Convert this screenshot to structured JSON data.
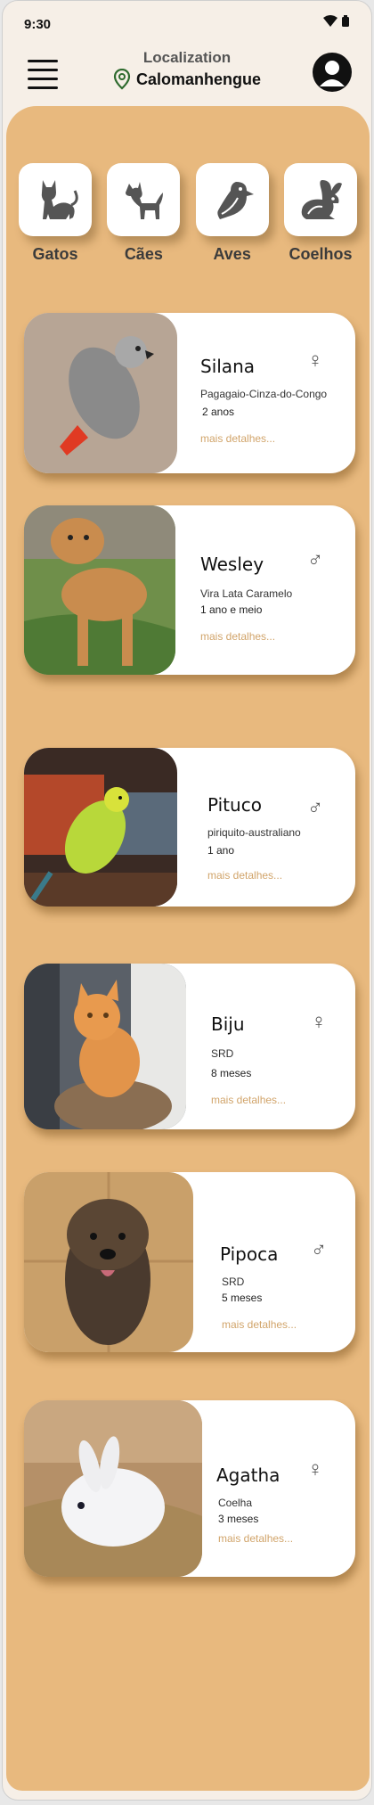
{
  "status": {
    "time": "9:30"
  },
  "header": {
    "location_label": "Localization",
    "city": "Calomanhengue"
  },
  "categories": [
    {
      "label": "Gatos",
      "icon": "cat-icon"
    },
    {
      "label": "Cães",
      "icon": "dog-icon"
    },
    {
      "label": "Aves",
      "icon": "bird-icon"
    },
    {
      "label": "Coelhos",
      "icon": "rabbit-icon"
    }
  ],
  "pets": [
    {
      "name": "Silana",
      "breed": "Pagagaio-Cinza-do-Congo",
      "age": "2 anos",
      "more": "mais detalhes...",
      "sex": "♀"
    },
    {
      "name": "Wesley",
      "breed": "Vira Lata Caramelo",
      "age": "1 ano e meio",
      "more": "mais detalhes...",
      "sex": "♂"
    },
    {
      "name": "Pituco",
      "breed": "piriquito-australiano",
      "age": "1 ano",
      "more": "mais detalhes...",
      "sex": "♂"
    },
    {
      "name": "Biju",
      "breed": "SRD",
      "age": "8 meses",
      "more": "mais detalhes...",
      "sex": "♀"
    },
    {
      "name": "Pipoca",
      "breed": "SRD",
      "age": "5 meses",
      "more": "mais detalhes...",
      "sex": "♂"
    },
    {
      "name": "Agatha",
      "breed": "Coelha",
      "age": "3 meses",
      "more": "mais detalhes...",
      "sex": "♀"
    }
  ],
  "colors": {
    "panel": "#e8b97e",
    "accent": "#d1a46a",
    "background": "#f6efe7"
  }
}
